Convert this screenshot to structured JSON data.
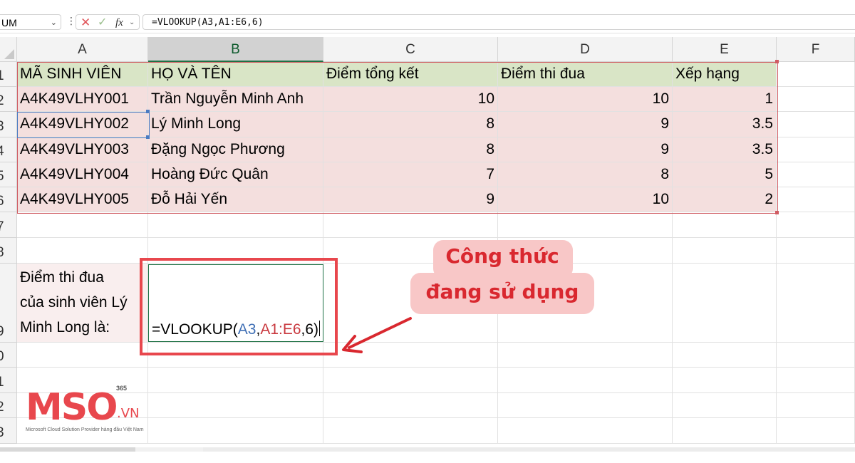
{
  "formula_bar": {
    "name_box": "UM",
    "formula": "=VLOOKUP(A3,A1:E6,6)",
    "cancel_icon": "x-icon",
    "enter_icon": "check-icon",
    "fx_label": "fx"
  },
  "columns": [
    "A",
    "B",
    "C",
    "D",
    "E",
    "F"
  ],
  "rows": [
    "1",
    "2",
    "3",
    "4",
    "5",
    "6",
    "7",
    "8",
    "9",
    "0",
    "1",
    "2",
    "3"
  ],
  "table": {
    "headers": [
      "MÃ SINH VIÊN",
      "HỌ VÀ TÊN",
      "Điểm tổng kết",
      "Điểm thi đua",
      "Xếp hạng"
    ],
    "rows": [
      [
        "A4K49VLHY001",
        "Trần Nguyễn Minh Anh",
        "10",
        "10",
        "1"
      ],
      [
        "A4K49VLHY002",
        "Lý Minh Long",
        "8",
        "9",
        "3.5"
      ],
      [
        "A4K49VLHY003",
        "Đặng Ngọc Phương",
        "8",
        "9",
        "3.5"
      ],
      [
        "A4K49VLHY004",
        "Hoàng Đức Quân",
        "7",
        "8",
        "5"
      ],
      [
        "A4K49VLHY005",
        "Đỗ Hải Yến",
        "9",
        "10",
        "2"
      ]
    ]
  },
  "note": {
    "line1": "Điểm thi đua",
    "line2": "của sinh viên Lý",
    "line3": "Minh Long là:"
  },
  "edit_cell": {
    "prefix": "=VLOOKUP(",
    "ref1": "A3",
    "sep1": ",",
    "ref2": "A1:E6",
    "suffix": ",6)"
  },
  "callout": {
    "line1": "Công thức",
    "line2": "đang sử dụng"
  },
  "logo": {
    "text": "MSO",
    "superscript": "365",
    "domain": ".VN",
    "tagline": "Microsoft Cloud Solution Provider hàng đầu Việt Nam"
  },
  "colors": {
    "header_fill": "#d9e5c6",
    "data_fill": "#f4dfde",
    "accent_red": "#e8474d",
    "ref_blue": "#3f6fb5",
    "excel_green": "#1e7145"
  }
}
